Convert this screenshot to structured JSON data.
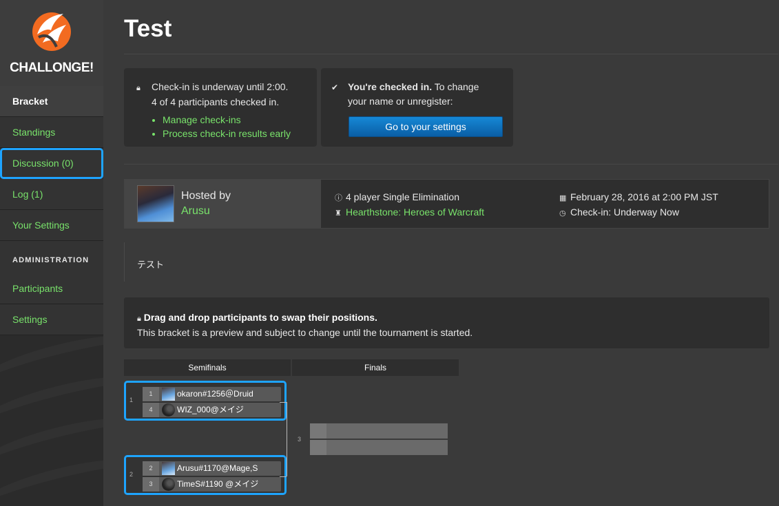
{
  "sidebar": {
    "logo_text": "CHALLONGE!",
    "items": [
      {
        "label": "Bracket"
      },
      {
        "label": "Standings"
      },
      {
        "label": "Discussion (0)"
      },
      {
        "label": "Log (1)"
      },
      {
        "label": "Your Settings"
      }
    ],
    "admin_heading": "ADMINISTRATION",
    "admin_items": [
      {
        "label": "Participants"
      },
      {
        "label": "Settings"
      }
    ]
  },
  "page": {
    "title": "Test"
  },
  "checkin_panel": {
    "line1": "Check-in is underway until 2:00.",
    "line2": "4 of 4 participants checked in.",
    "links": [
      "Manage check-ins",
      "Process check-in results early"
    ]
  },
  "status_panel": {
    "strong": "You're checked in.",
    "rest1": " To change",
    "line2": "your name or unregister:",
    "button_label": "Go to your settings"
  },
  "info": {
    "hosted_by_label": "Hosted by",
    "host_name": "Arusu",
    "format": "4 player Single Elimination",
    "game": "Hearthstone: Heroes of Warcraft",
    "date": "February 28, 2016 at 2:00 PM JST",
    "checkin_status": "Check-in: Underway Now"
  },
  "description": "テスト",
  "notice": {
    "title": "Drag and drop participants to swap their positions.",
    "body": "This bracket is a preview and subject to change until the tournament is started."
  },
  "bracket": {
    "rounds": [
      "Semifinals",
      "Finals"
    ],
    "matches": [
      {
        "id": "1",
        "players": [
          {
            "seed": "1",
            "name": "okaron#1256＠Druid",
            "avatar": "person"
          },
          {
            "seed": "4",
            "name": "WIZ_000@メイジ",
            "avatar": "swirl"
          }
        ]
      },
      {
        "id": "2",
        "players": [
          {
            "seed": "2",
            "name": "Arusu#1170@Mage,S",
            "avatar": "person"
          },
          {
            "seed": "3",
            "name": "TimeS#1190 @メイジ",
            "avatar": "swirl"
          }
        ]
      }
    ],
    "final_id": "3"
  },
  "colors": {
    "accent_link": "#79e36b",
    "highlight": "#1ea4ff",
    "button": "#0f72bd",
    "logo": "#f26b21"
  }
}
